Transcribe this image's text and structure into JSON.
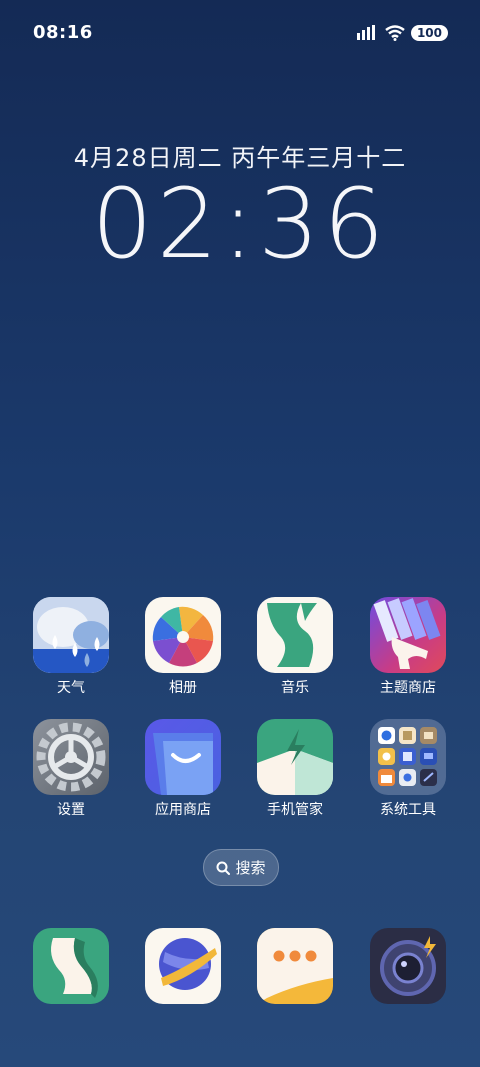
{
  "status_bar": {
    "time": "08:16",
    "battery": "100"
  },
  "clock": {
    "date": "4月28日周二 丙午年三月十二",
    "time": "02:36"
  },
  "apps": [
    {
      "label": "天气",
      "icon": "weather-icon"
    },
    {
      "label": "相册",
      "icon": "gallery-icon"
    },
    {
      "label": "音乐",
      "icon": "music-icon"
    },
    {
      "label": "主题商店",
      "icon": "theme-store-icon"
    },
    {
      "label": "设置",
      "icon": "settings-icon"
    },
    {
      "label": "应用商店",
      "icon": "app-store-icon"
    },
    {
      "label": "手机管家",
      "icon": "phone-manager-icon"
    },
    {
      "label": "系统工具",
      "icon": "system-tools-folder-icon"
    }
  ],
  "search": {
    "label": "搜索"
  },
  "dock": [
    {
      "icon": "phone-icon"
    },
    {
      "icon": "browser-icon"
    },
    {
      "icon": "messages-icon"
    },
    {
      "icon": "camera-icon"
    }
  ]
}
